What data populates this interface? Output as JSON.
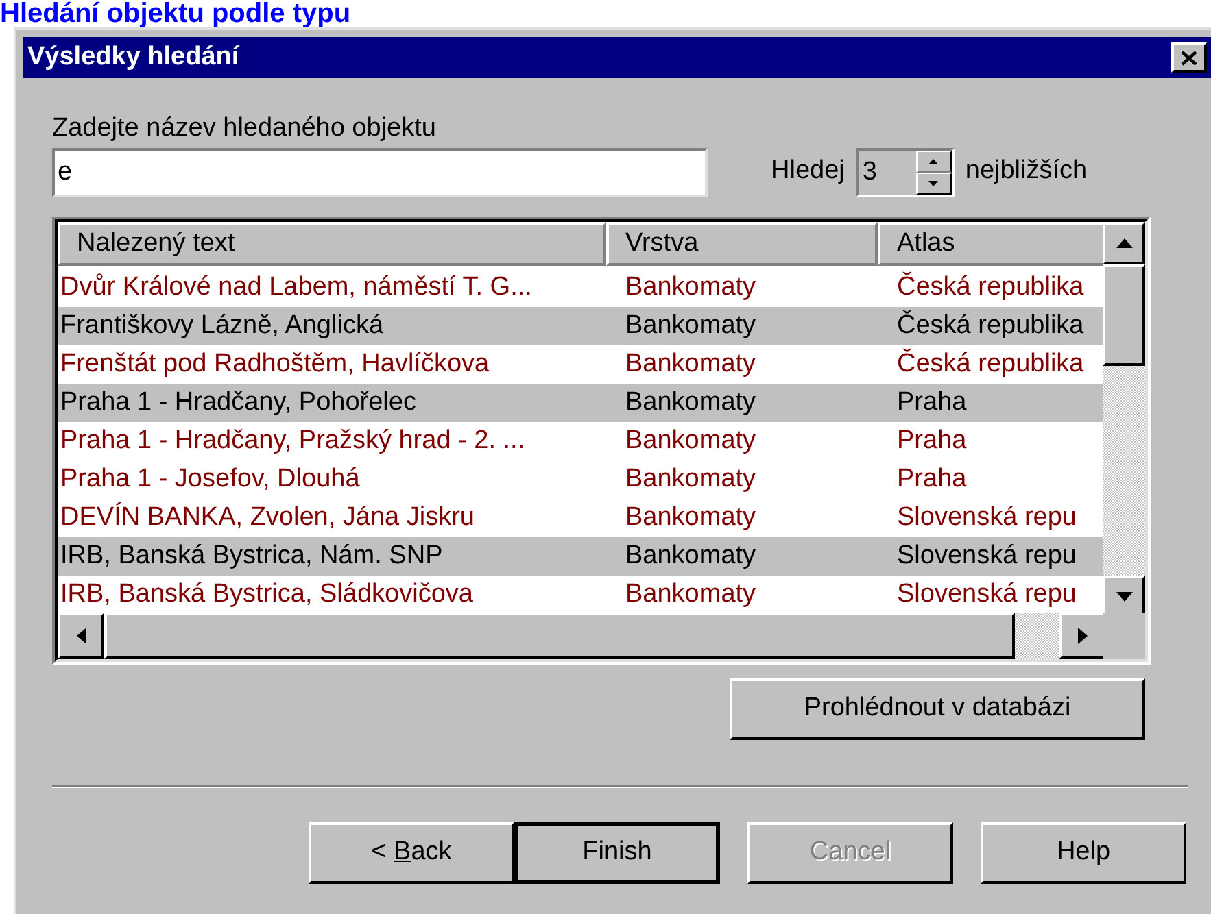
{
  "page_heading": "Hledání objektu podle typu",
  "window": {
    "title": "Výsledky hledání"
  },
  "search": {
    "label": "Zadejte název hledaného objektu",
    "value": "e"
  },
  "count": {
    "label_before": "Hledej",
    "value": "3",
    "label_after": "nejbližších"
  },
  "table": {
    "columns": [
      "Nalezený text",
      "Vrstva",
      "Atlas"
    ],
    "rows": [
      {
        "selected": false,
        "cells": [
          "Dvůr Králové nad Labem, náměstí T. G...",
          "Bankomaty",
          "Česká republika"
        ]
      },
      {
        "selected": true,
        "cells": [
          "Františkovy Lázně, Anglická",
          "Bankomaty",
          "Česká republika"
        ]
      },
      {
        "selected": false,
        "cells": [
          "Frenštát pod Radhoštěm, Havlíčkova",
          "Bankomaty",
          "Česká republika"
        ]
      },
      {
        "selected": true,
        "cells": [
          "Praha 1 - Hradčany, Pohořelec",
          "Bankomaty",
          "Praha"
        ]
      },
      {
        "selected": false,
        "cells": [
          "Praha 1 - Hradčany, Pražský hrad - 2. ...",
          "Bankomaty",
          "Praha"
        ]
      },
      {
        "selected": false,
        "cells": [
          "Praha 1 - Josefov, Dlouhá",
          "Bankomaty",
          "Praha"
        ]
      },
      {
        "selected": false,
        "cells": [
          "DEVÍN BANKA, Zvolen, Jána Jiskru",
          "Bankomaty",
          "Slovenská repu"
        ]
      },
      {
        "selected": true,
        "cells": [
          "IRB, Banská Bystrica, Nám. SNP",
          "Bankomaty",
          "Slovenská repu"
        ]
      },
      {
        "selected": false,
        "cells": [
          "IRB, Banská Bystrica, Sládkovičova",
          "Bankomaty",
          "Slovenská repu"
        ]
      }
    ]
  },
  "browse_button": {
    "label": "Prohlédnout v databázi"
  },
  "buttons": [
    {
      "label_parts": [
        {
          "text": "< ",
          "underlined": false
        },
        {
          "text": "B",
          "underlined": true
        },
        {
          "text": "ack",
          "underlined": false
        }
      ],
      "default": false,
      "disabled": false
    },
    {
      "label_parts": [
        {
          "text": "Finish",
          "underlined": false
        }
      ],
      "default": true,
      "disabled": false
    },
    {
      "label_parts": [
        {
          "text": "Cancel",
          "underlined": false
        }
      ],
      "default": false,
      "disabled": true
    },
    {
      "label_parts": [
        {
          "text": "Help",
          "underlined": false
        }
      ],
      "default": false,
      "disabled": false
    }
  ]
}
